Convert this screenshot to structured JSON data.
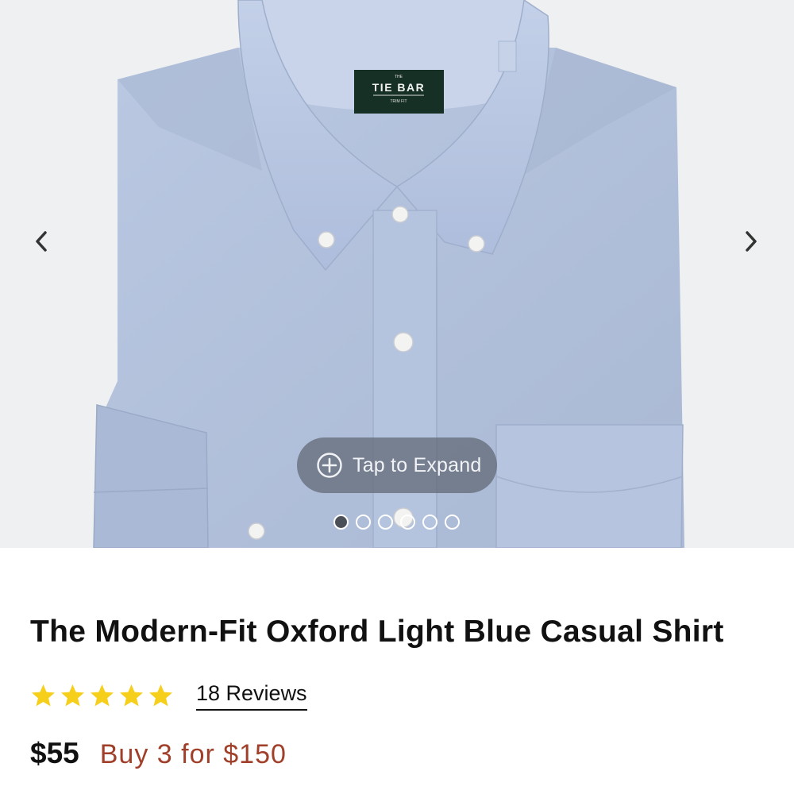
{
  "gallery": {
    "image_label": {
      "brand_small": "THE",
      "brand": "TIE BAR",
      "fit": "TRIM FIT"
    },
    "expand_label": "Tap to Expand",
    "image_count": 6,
    "active_image_index": 0,
    "prev_icon": "chevron-left-icon",
    "next_icon": "chevron-right-icon"
  },
  "product": {
    "title": "The Modern-Fit Oxford Light Blue Casual Shirt",
    "rating": 5,
    "rating_max": 5,
    "reviews_label": "18 Reviews",
    "price": "$55",
    "promo": "Buy 3 for $150"
  },
  "colors": {
    "star": "#f5cf1a",
    "promo": "#a0402a",
    "shirt": "#b3c2dd"
  }
}
